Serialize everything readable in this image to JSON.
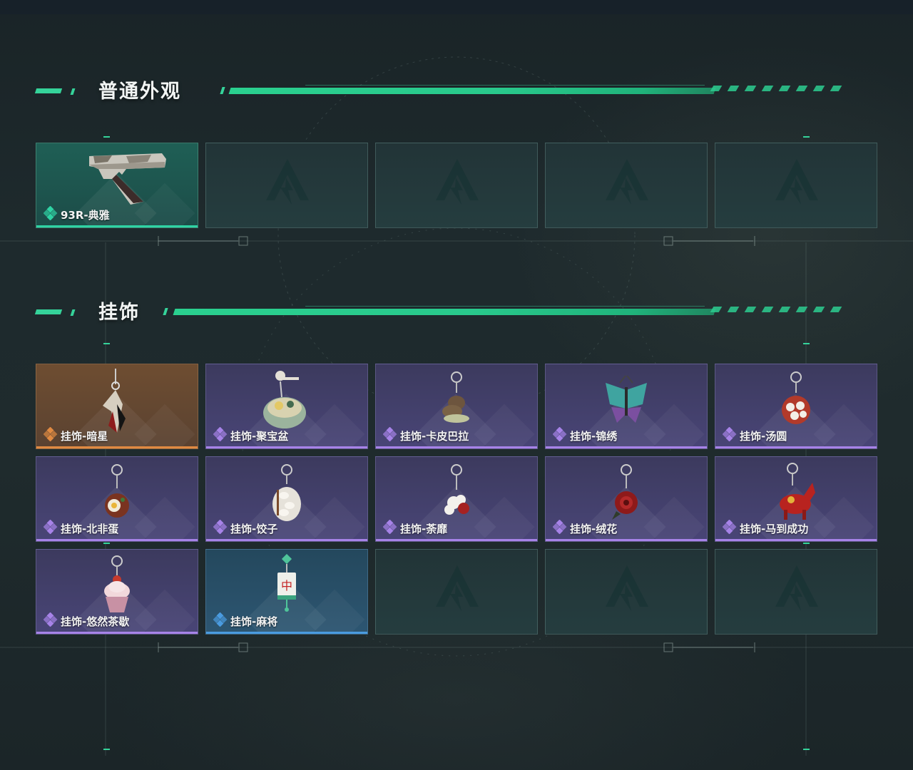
{
  "sections": {
    "skins": {
      "title": "普通外观",
      "items": [
        {
          "label": "93R-典雅",
          "rarity": "green",
          "icon": "pistol-icon"
        }
      ]
    },
    "charms": {
      "title": "挂饰",
      "items": [
        {
          "label": "挂饰-暗星",
          "rarity": "orange",
          "icon": "dark-star-charm-icon"
        },
        {
          "label": "挂饰-聚宝盆",
          "rarity": "purple",
          "icon": "treasure-bowl-charm-icon"
        },
        {
          "label": "挂饰-卡皮巴拉",
          "rarity": "purple",
          "icon": "capybara-charm-icon"
        },
        {
          "label": "挂饰-锦绣",
          "rarity": "purple",
          "icon": "butterfly-charm-icon"
        },
        {
          "label": "挂饰-汤圆",
          "rarity": "purple",
          "icon": "tangyuan-charm-icon"
        },
        {
          "label": "挂饰-北非蛋",
          "rarity": "purple",
          "icon": "shakshuka-charm-icon"
        },
        {
          "label": "挂饰-饺子",
          "rarity": "purple",
          "icon": "dumpling-charm-icon"
        },
        {
          "label": "挂饰-荼靡",
          "rarity": "purple",
          "icon": "flower-charm-icon"
        },
        {
          "label": "挂饰-绒花",
          "rarity": "purple",
          "icon": "velvet-flower-charm-icon"
        },
        {
          "label": "挂饰-马到成功",
          "rarity": "purple",
          "icon": "horse-charm-icon"
        },
        {
          "label": "挂饰-悠然茶歇",
          "rarity": "purple",
          "icon": "cupcake-charm-icon"
        },
        {
          "label": "挂饰-麻将",
          "rarity": "blue",
          "icon": "mahjong-charm-icon"
        }
      ]
    }
  },
  "colors": {
    "accent": "#2ad08f",
    "rarity_green": "#2fd3a4",
    "rarity_orange": "#e08a42",
    "rarity_purple": "#a783e8",
    "rarity_blue": "#4a9be0"
  }
}
